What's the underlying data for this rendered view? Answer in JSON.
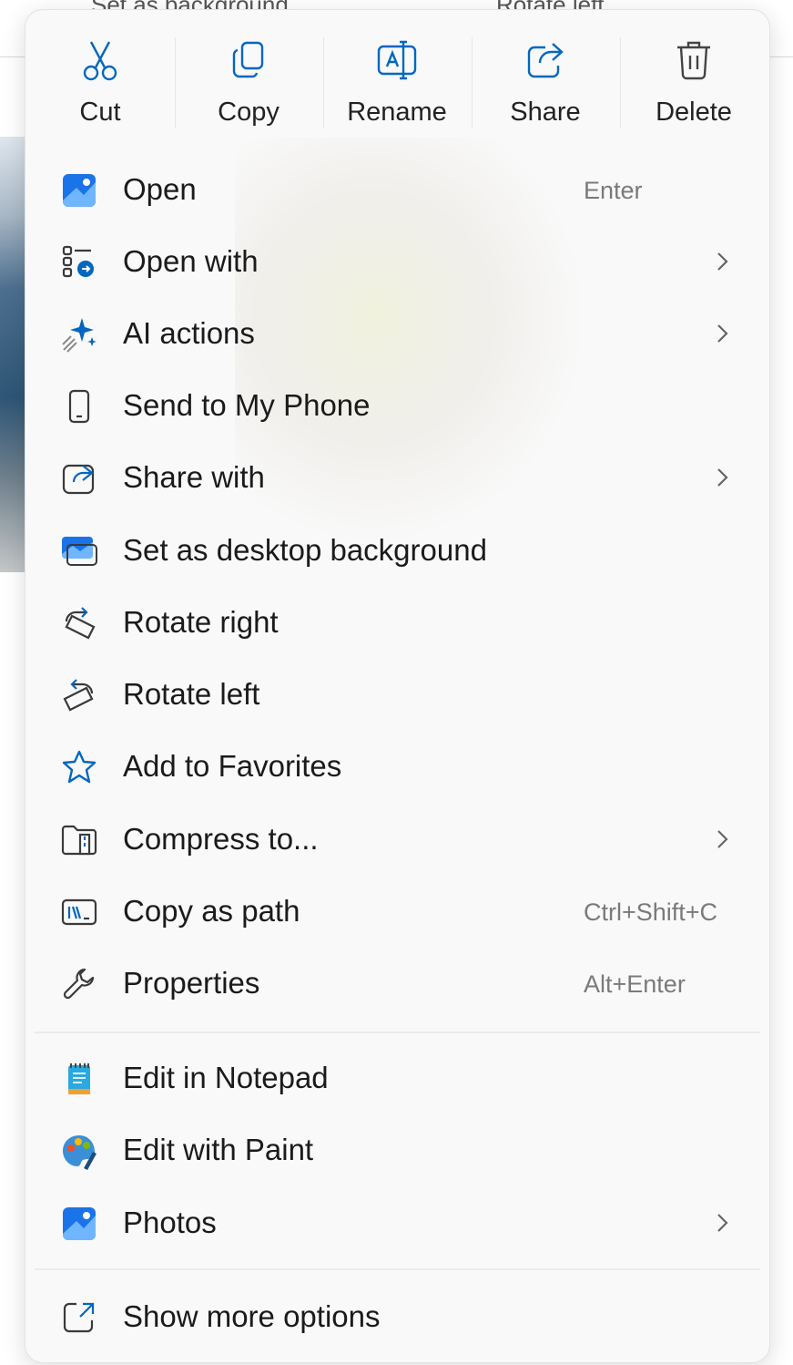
{
  "background": {
    "toolbar_fragments": [
      "Set as background",
      "Rotate left"
    ]
  },
  "top_actions": [
    {
      "label": "Cut",
      "icon": "scissors-icon"
    },
    {
      "label": "Copy",
      "icon": "copy-icon"
    },
    {
      "label": "Rename",
      "icon": "rename-icon"
    },
    {
      "label": "Share",
      "icon": "share-icon"
    },
    {
      "label": "Delete",
      "icon": "trash-icon"
    }
  ],
  "menu_items": [
    {
      "label": "Open",
      "shortcut": "Enter",
      "icon": "photos-app-icon"
    },
    {
      "label": "Open with",
      "submenu": true,
      "icon": "open-with-icon"
    },
    {
      "label": "AI actions",
      "submenu": true,
      "icon": "sparkle-icon"
    },
    {
      "label": "Send to My Phone",
      "icon": "phone-icon"
    },
    {
      "label": "Share with",
      "submenu": true,
      "icon": "share-with-icon"
    },
    {
      "label": "Set as desktop background",
      "icon": "desktop-background-icon"
    },
    {
      "label": "Rotate right",
      "icon": "rotate-right-icon"
    },
    {
      "label": "Rotate left",
      "icon": "rotate-left-icon"
    },
    {
      "label": "Add to Favorites",
      "icon": "star-icon"
    },
    {
      "label": "Compress to...",
      "submenu": true,
      "icon": "zip-folder-icon"
    },
    {
      "label": "Copy as path",
      "shortcut": "Ctrl+Shift+C",
      "icon": "copy-path-icon"
    },
    {
      "label": "Properties",
      "shortcut": "Alt+Enter",
      "icon": "wrench-icon"
    }
  ],
  "app_items": [
    {
      "label": "Edit in Notepad",
      "icon": "notepad-icon"
    },
    {
      "label": "Edit with Paint",
      "icon": "paint-icon"
    },
    {
      "label": "Photos",
      "submenu": true,
      "icon": "photos-app-icon"
    }
  ],
  "footer_item": {
    "label": "Show more options",
    "icon": "show-more-icon"
  },
  "colors": {
    "accent": "#0067c0",
    "menu_bg": "#f9f9f9"
  }
}
